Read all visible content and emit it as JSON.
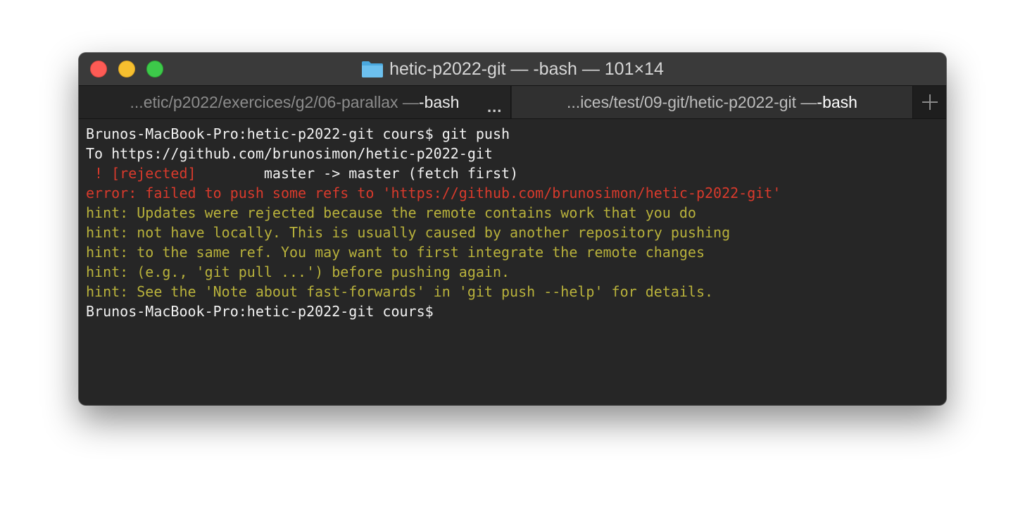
{
  "window": {
    "title": "hetic-p2022-git — -bash — 101×14",
    "title_icon": "folder-icon"
  },
  "tabs": [
    {
      "path": "...etic/p2022/exercices/g2/06-parallax — ",
      "command": "-bash",
      "active": false
    },
    {
      "path": "...ices/test/09-git/hetic-p2022-git — ",
      "command": "-bash",
      "active": true
    }
  ],
  "tab_overflow": "...",
  "new_tab_icon": "plus-icon",
  "terminal": {
    "lines": [
      {
        "text": "Brunos-MacBook-Pro:hetic-p2022-git cours$ git push",
        "color": "#f2f2f2"
      },
      {
        "text": "To https://github.com/brunosimon/hetic-p2022-git",
        "color": "#f2f2f2"
      },
      {
        "parts": [
          {
            "text": " ! [rejected]",
            "color": "#d93a2c"
          },
          {
            "text": "        master -> master (fetch first)",
            "color": "#f2f2f2"
          }
        ]
      },
      {
        "text": "error: failed to push some refs to 'https://github.com/brunosimon/hetic-p2022-git'",
        "color": "#d93a2c"
      },
      {
        "text": "hint: Updates were rejected because the remote contains work that you do",
        "color": "#b8b13b"
      },
      {
        "text": "hint: not have locally. This is usually caused by another repository pushing",
        "color": "#b8b13b"
      },
      {
        "text": "hint: to the same ref. You may want to first integrate the remote changes",
        "color": "#b8b13b"
      },
      {
        "text": "hint: (e.g., 'git pull ...') before pushing again.",
        "color": "#b8b13b"
      },
      {
        "text": "hint: See the 'Note about fast-forwards' in 'git push --help' for details.",
        "color": "#b8b13b"
      },
      {
        "text": "Brunos-MacBook-Pro:hetic-p2022-git cours$ ",
        "color": "#f2f2f2"
      }
    ]
  },
  "colors": {
    "close": "#fd5b55",
    "minimize": "#f6bf2f",
    "maximize": "#3dc94a",
    "terminal_bg": "#262626",
    "error": "#d93a2c",
    "hint": "#b8b13b",
    "text": "#f2f2f2"
  }
}
